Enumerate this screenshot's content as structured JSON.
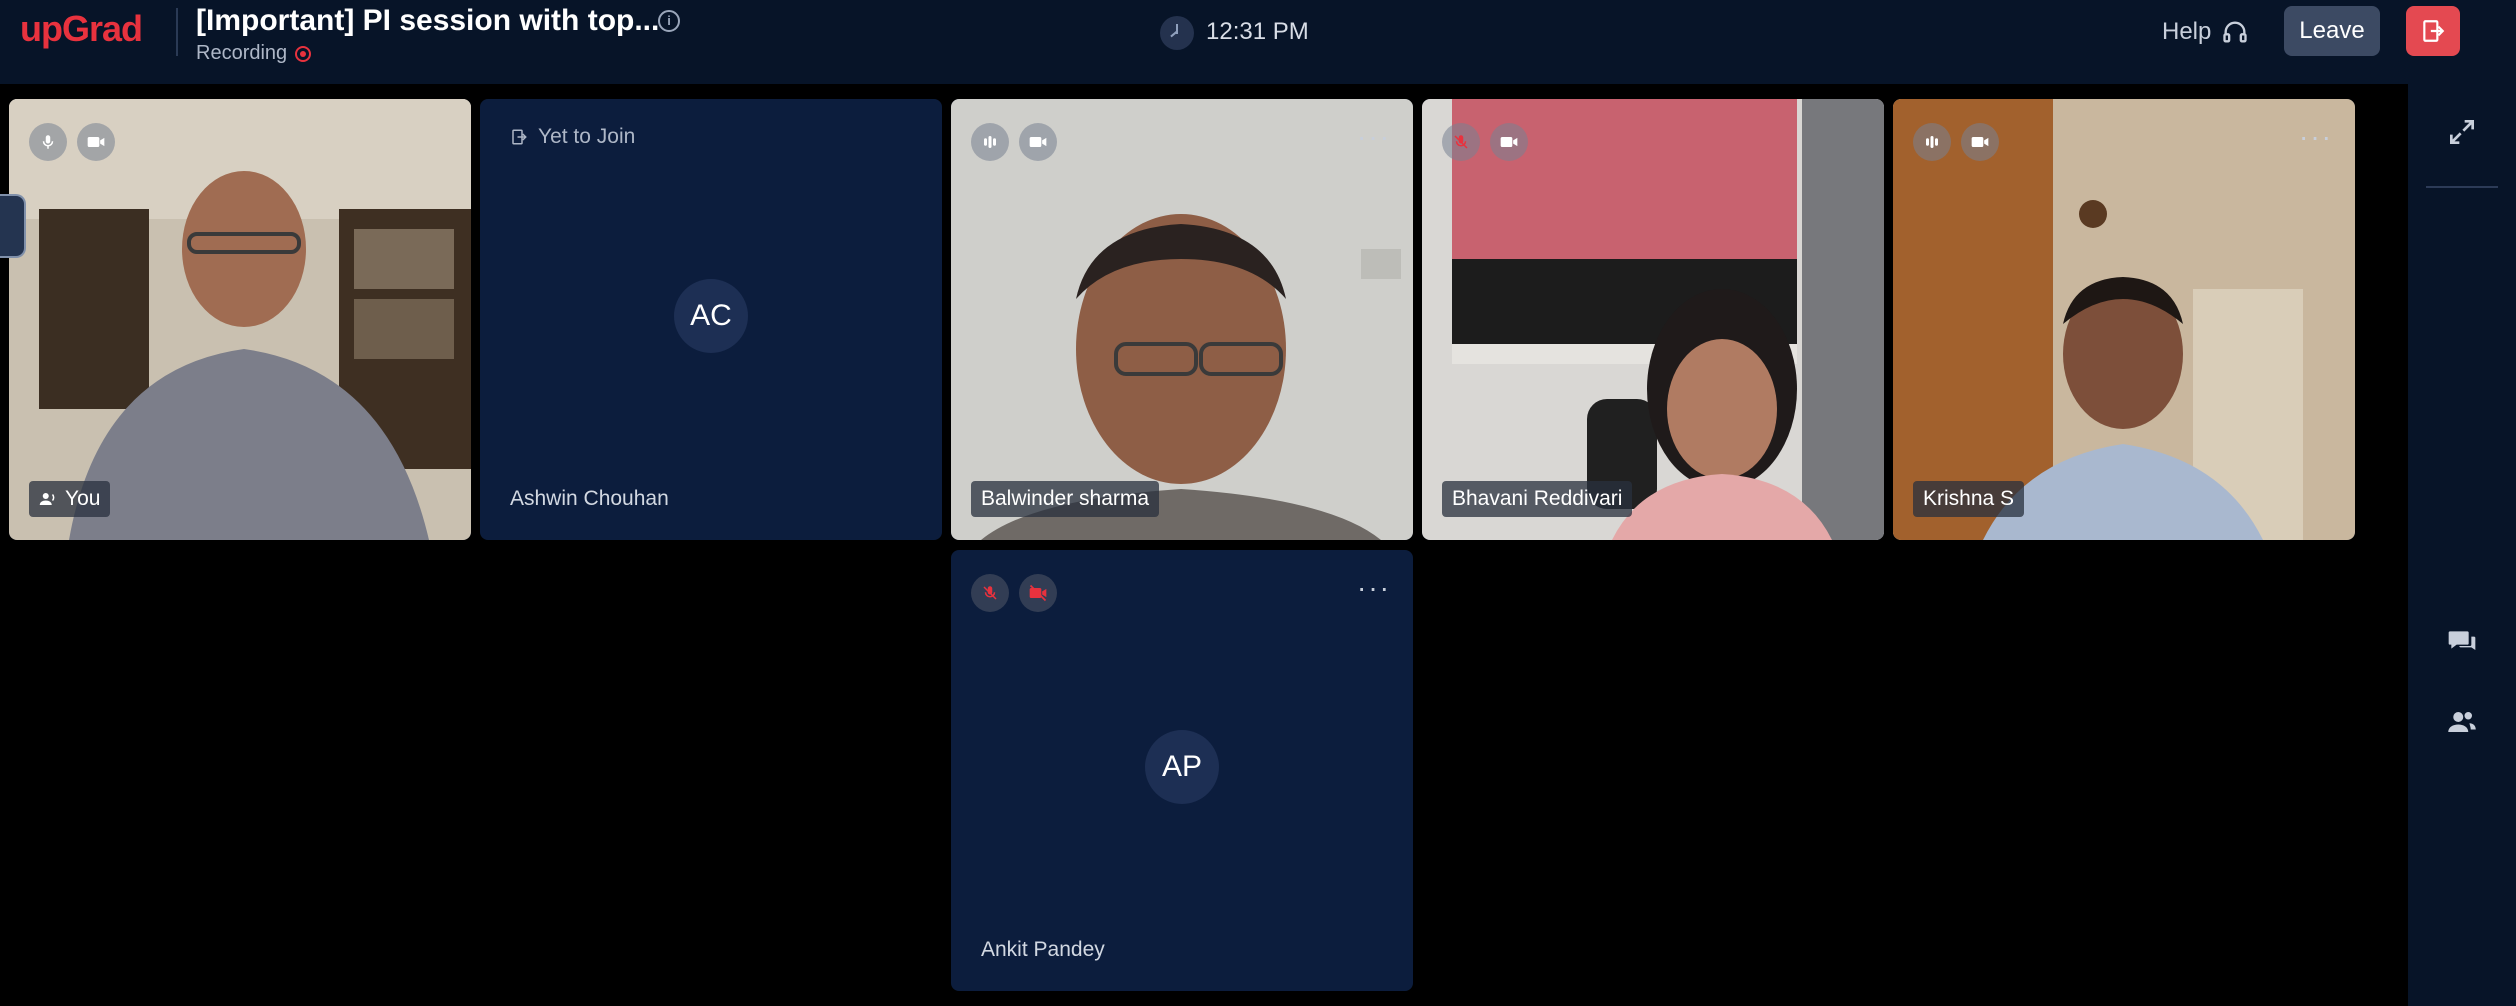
{
  "header": {
    "logo": "upGrad",
    "title": "[Important] PI session with top...",
    "recording_label": "Recording",
    "time": "12:31 PM",
    "help_label": "Help",
    "leave_label": "Leave"
  },
  "participants": [
    {
      "name": "You",
      "status": "",
      "initials": "",
      "mic": "on",
      "cam": "on",
      "video": true
    },
    {
      "name": "Ashwin Chouhan",
      "status": "Yet to Join",
      "initials": "AC",
      "video": false
    },
    {
      "name": "Balwinder sharma",
      "status": "",
      "initials": "",
      "mic": "speaking",
      "cam": "on",
      "video": true
    },
    {
      "name": "Bhavani Reddivari",
      "status": "",
      "initials": "",
      "mic": "muted",
      "cam": "on",
      "video": true
    },
    {
      "name": "Krishna S",
      "status": "",
      "initials": "",
      "mic": "speaking",
      "cam": "on",
      "video": true
    },
    {
      "name": "Ankit Pandey",
      "status": "",
      "initials": "AP",
      "mic": "muted",
      "cam": "off",
      "video": false
    }
  ],
  "colors": {
    "brand": "#e8323e",
    "topbar": "#071428",
    "tile": "#0c1d3d",
    "leave": "#e44951"
  },
  "icons": [
    "info-icon",
    "record-icon",
    "clock-icon",
    "headphones-icon",
    "exit-icon",
    "expand-icon",
    "chat-icon",
    "participants-icon",
    "mic-icon",
    "camera-icon",
    "more-icon"
  ]
}
